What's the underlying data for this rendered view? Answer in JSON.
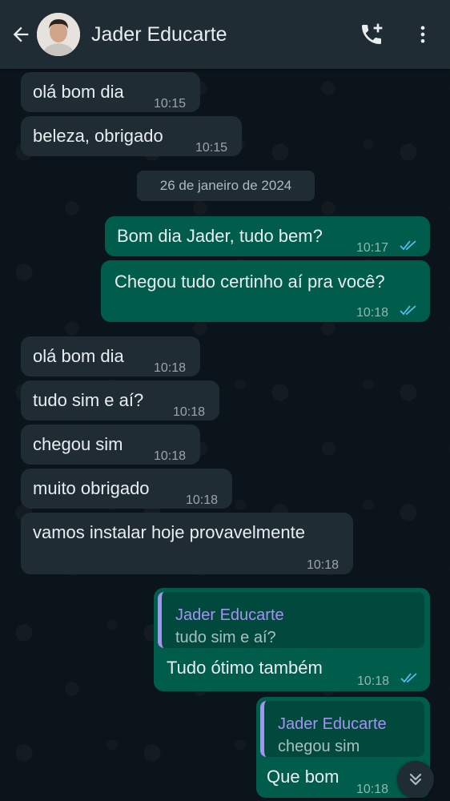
{
  "header": {
    "contact_name": "Jader Educarte",
    "back_icon": "arrow-left-icon",
    "add_call_icon": "phone-plus-icon",
    "menu_icon": "more-vertical-icon"
  },
  "date_divider": "26 de janeiro de 2024",
  "messages": [
    {
      "dir": "in",
      "text": "olá bom dia",
      "time": "10:15"
    },
    {
      "dir": "in",
      "text": "beleza, obrigado",
      "time": "10:15"
    },
    {
      "dir": "out",
      "text": "Bom dia Jader, tudo bem?",
      "time": "10:17",
      "status": "read"
    },
    {
      "dir": "out",
      "text": "Chegou tudo certinho aí pra você?",
      "time": "10:18",
      "status": "read"
    },
    {
      "dir": "in",
      "text": "olá bom dia",
      "time": "10:18"
    },
    {
      "dir": "in",
      "text": "tudo sim e aí?",
      "time": "10:18"
    },
    {
      "dir": "in",
      "text": "chegou sim",
      "time": "10:18"
    },
    {
      "dir": "in",
      "text": "muito obrigado",
      "time": "10:18"
    },
    {
      "dir": "in",
      "text": "vamos instalar hoje provavelmente",
      "time": "10:18"
    },
    {
      "dir": "out",
      "quote_name": "Jader Educarte",
      "quote_text": "tudo sim e aí?",
      "text": "Tudo ótimo também",
      "time": "10:18",
      "status": "read"
    },
    {
      "dir": "out",
      "quote_name": "Jader Educarte",
      "quote_text": "chegou sim",
      "text": "Que bom",
      "time": "10:18",
      "status": "read"
    }
  ],
  "colors": {
    "incoming_bubble": "#1f2c34",
    "outgoing_bubble": "#005c4b",
    "read_ticks": "#53bdeb",
    "quote_accent": "#a791f4"
  },
  "scroll_icon": "double-chevron-down-icon"
}
